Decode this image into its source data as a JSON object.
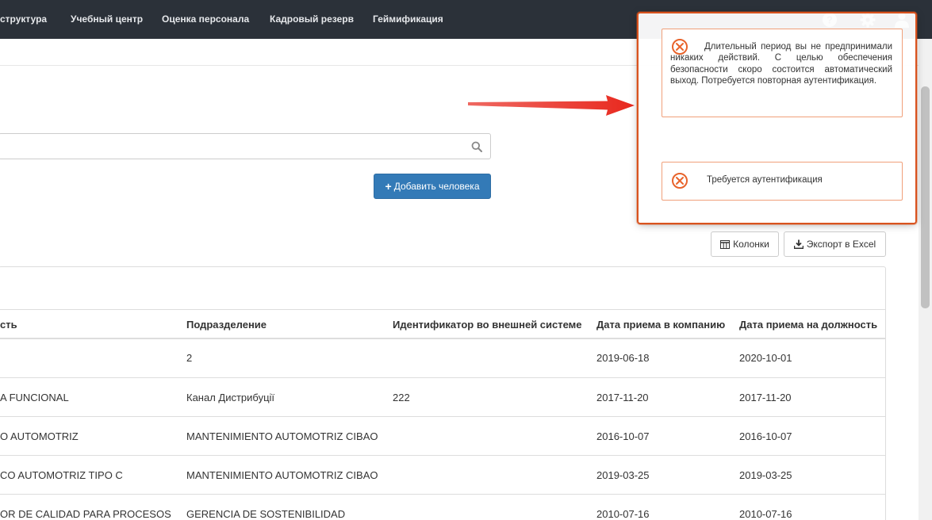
{
  "nav": {
    "items": [
      "структура",
      "Учебный центр",
      "Оценка персонала",
      "Кадровый резерв",
      "Геймификация"
    ],
    "icons": [
      "help-icon",
      "gear-icon",
      "user-icon"
    ]
  },
  "search": {
    "value": "",
    "placeholder": ""
  },
  "add_button": {
    "label": "Добавить человека",
    "icon": "plus-icon"
  },
  "toolbar": {
    "columns_label": "Колонки",
    "export_label": "Экспорт в Excel"
  },
  "table": {
    "headers": [
      "сть",
      "Подразделение",
      "Идентификатор во внешней системе",
      "Дата приема в компанию",
      "Дата приема на должность"
    ],
    "rows": [
      [
        "",
        "2",
        "",
        "2019-06-18",
        "2020-10-01"
      ],
      [
        "A FUNCIONAL",
        "Канал Дистрибуції",
        "222",
        "2017-11-20",
        "2017-11-20"
      ],
      [
        "O AUTOMOTRIZ",
        "MANTENIMIENTO AUTOMOTRIZ CIBAO",
        "",
        "2016-10-07",
        "2016-10-07"
      ],
      [
        "CO AUTOMOTRIZ TIPO C",
        "MANTENIMIENTO AUTOMOTRIZ CIBAO",
        "",
        "2019-03-25",
        "2019-03-25"
      ],
      [
        "OR DE CALIDAD PARA PROCESOS",
        "GERENCIA DE SOSTENIBILIDAD",
        "",
        "2010-07-16",
        "2010-07-16"
      ]
    ]
  },
  "notifications": [
    {
      "text": "Длительный период вы не предпринимали никаких действий. С целью обеспечения безопасности скоро состоится автоматический выход. Потребуется повторная аутентификация.",
      "icon": "error-circle-icon"
    },
    {
      "text": "Требуется аутентификация",
      "icon": "error-circle-icon"
    }
  ],
  "colors": {
    "nav_bg": "#2b3139",
    "primary": "#337ab7",
    "toast_border": "#f0a07a",
    "error_icon": "#e8632b",
    "highlight": "#d9531e",
    "arrow": "#e8281e"
  }
}
